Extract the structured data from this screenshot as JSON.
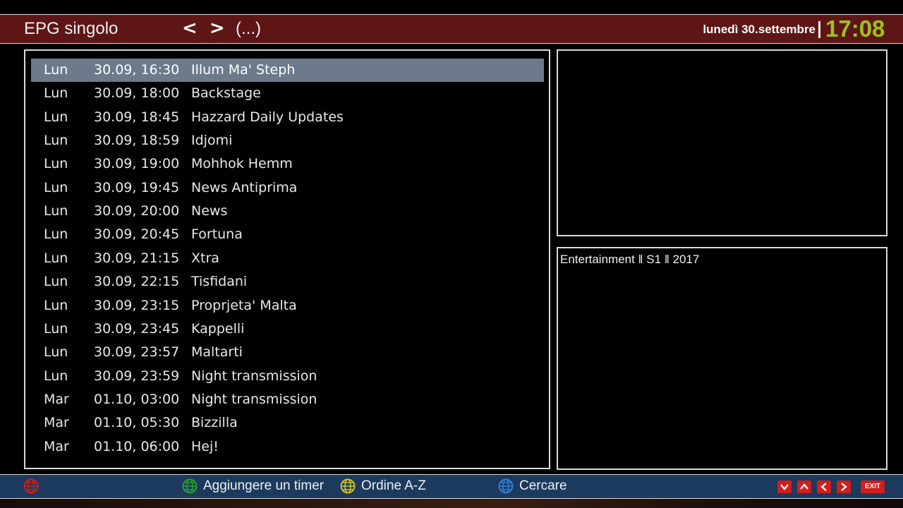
{
  "header": {
    "title": "EPG singolo",
    "nav_arrows": "< >",
    "channel": "(...)",
    "date": "lunedì 30.settembre",
    "time": "17:08",
    "accent_color": "#9bc31a",
    "bar_color": "#5e1515"
  },
  "events": [
    {
      "day": "Lun",
      "datetime": "30.09, 16:30",
      "title": "Illum Ma' Steph",
      "selected": true
    },
    {
      "day": "Lun",
      "datetime": "30.09, 18:00",
      "title": "Backstage"
    },
    {
      "day": "Lun",
      "datetime": "30.09, 18:45",
      "title": "Hazzard Daily Updates"
    },
    {
      "day": "Lun",
      "datetime": "30.09, 18:59",
      "title": "Idjomi"
    },
    {
      "day": "Lun",
      "datetime": "30.09, 19:00",
      "title": "Mohhok Hemm"
    },
    {
      "day": "Lun",
      "datetime": "30.09, 19:45",
      "title": "News Antiprima"
    },
    {
      "day": "Lun",
      "datetime": "30.09, 20:00",
      "title": "News"
    },
    {
      "day": "Lun",
      "datetime": "30.09, 20:45",
      "title": "Fortuna"
    },
    {
      "day": "Lun",
      "datetime": "30.09, 21:15",
      "title": "Xtra"
    },
    {
      "day": "Lun",
      "datetime": "30.09, 22:15",
      "title": "Tisfidani"
    },
    {
      "day": "Lun",
      "datetime": "30.09, 23:15",
      "title": "Proprjeta' Malta"
    },
    {
      "day": "Lun",
      "datetime": "30.09, 23:45",
      "title": "Kappelli"
    },
    {
      "day": "Lun",
      "datetime": "30.09, 23:57",
      "title": "Maltarti"
    },
    {
      "day": "Lun",
      "datetime": "30.09, 23:59",
      "title": "Night transmission"
    },
    {
      "day": "Mar",
      "datetime": "01.10, 03:00",
      "title": "Night transmission"
    },
    {
      "day": "Mar",
      "datetime": "01.10, 05:30",
      "title": "Bizzilla"
    },
    {
      "day": "Mar",
      "datetime": "01.10, 06:00",
      "title": "Hej!"
    }
  ],
  "info": {
    "description": "Entertainment ‖ S1 ‖ 2017"
  },
  "footer": {
    "green_label": "Aggiungere un timer",
    "yellow_label": "Ordine A-Z",
    "blue_label": "Cercare",
    "exit_label": "EXIT",
    "keys": [
      "down-key",
      "up-key",
      "left-key",
      "right-key"
    ],
    "colors": {
      "red": "#d21d1d",
      "green": "#27a327",
      "yellow": "#d8c21a",
      "blue": "#2f7fd8"
    }
  }
}
